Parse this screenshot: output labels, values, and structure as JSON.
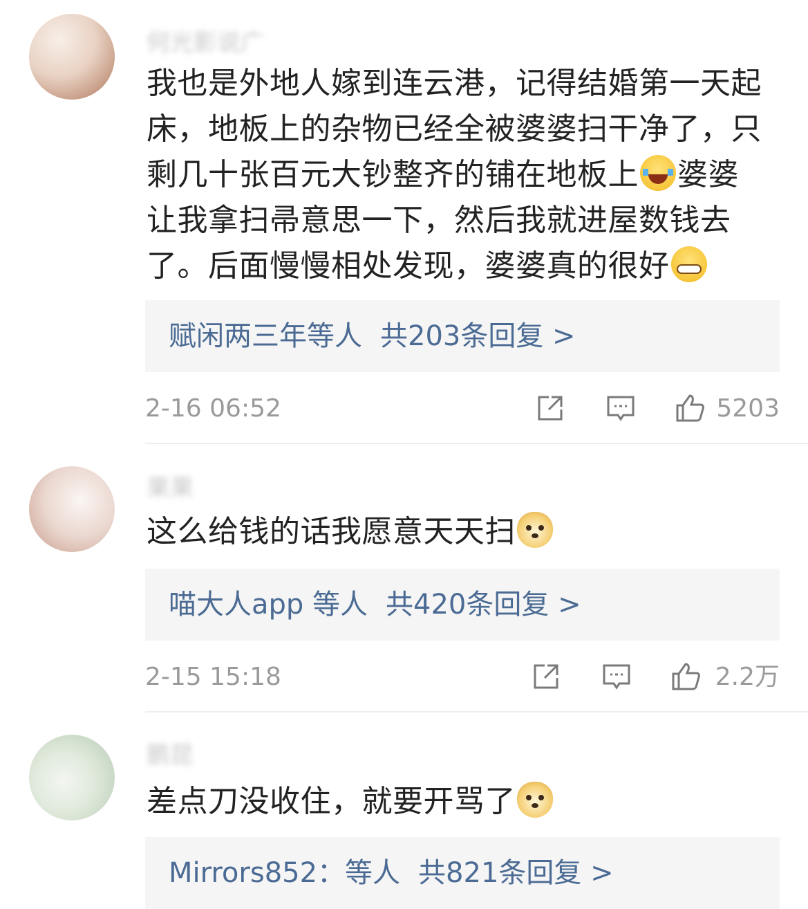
{
  "comments": [
    {
      "username": "何光影说广",
      "content_lines": [
        "我也是外地人嫁到连云港，记得结婚第一天起",
        "床，地板上的杂物已经全被婆婆扫干净了，只",
        "剩几十张百元大钞整齐的铺在地板上",
        "婆婆",
        "让我拿扫帚意思一下，然后我就进屋数钱去",
        "了。后面慢慢相处发现，婆婆真的很好"
      ],
      "emojis": [
        "laugh-emoji",
        "grin-emoji"
      ],
      "reply_names": "赋闲两三年等人",
      "reply_count": "共203条回复 >",
      "time": "2-16 06:52",
      "likes": "5203"
    },
    {
      "username": "果果",
      "content": "这么给钱的话我愿意天天扫",
      "emoji": "doge-emoji",
      "reply_names": "喵大人app 等人",
      "reply_count": "共420条回复 >",
      "time": "2-15 15:18",
      "likes": "2.2万"
    },
    {
      "username": "鹏昆",
      "content": "差点刀没收住，就要开骂了",
      "emoji": "doge-emoji",
      "reply_names": "Mirrors852：等人",
      "reply_count": "共821条回复 >"
    }
  ],
  "icons": {
    "share": "share-icon",
    "comment": "comment-icon",
    "like": "like-icon"
  },
  "colors": {
    "reply_text": "#4b6b94",
    "meta_text": "#9a9a9a",
    "reply_bg": "#f5f5f5",
    "body_text": "#222222"
  }
}
